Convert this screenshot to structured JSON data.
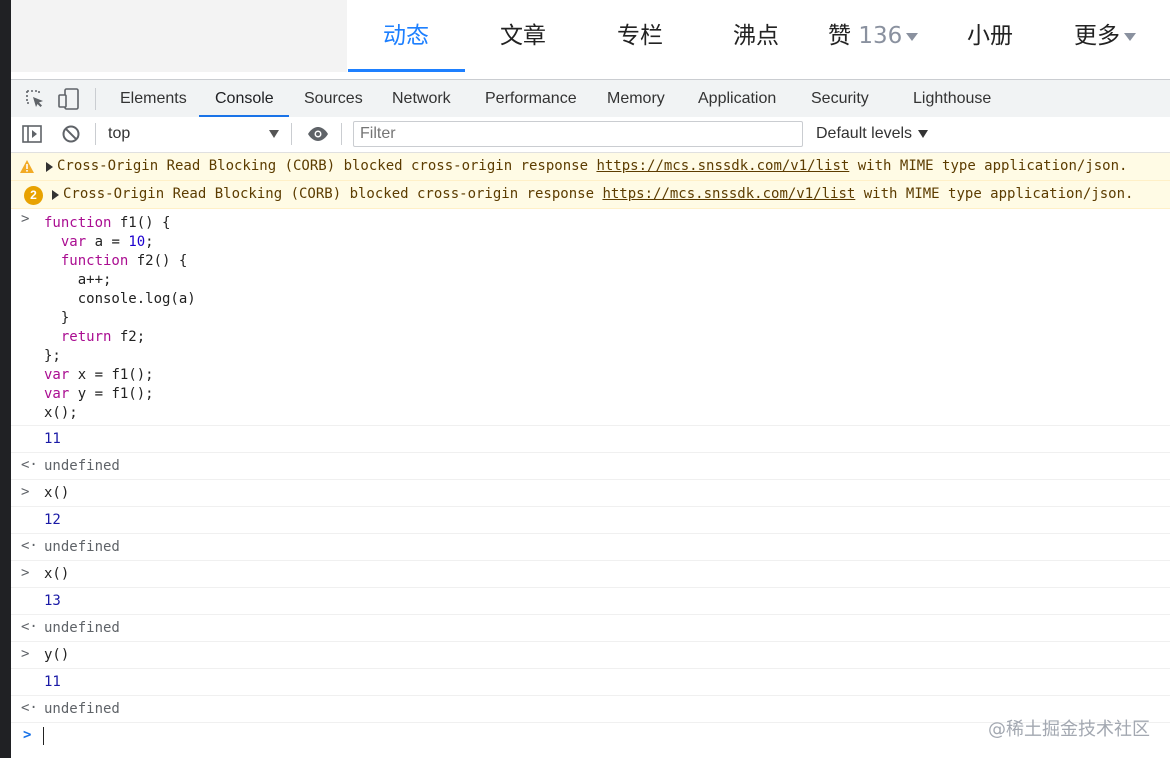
{
  "site_nav": {
    "items": [
      {
        "label": "动态"
      },
      {
        "label": "文章"
      },
      {
        "label": "专栏"
      },
      {
        "label": "沸点"
      },
      {
        "label": "赞",
        "count": "136"
      },
      {
        "label": "小册"
      },
      {
        "label": "更多"
      }
    ]
  },
  "devtools": {
    "tabs": [
      "Elements",
      "Console",
      "Sources",
      "Network",
      "Performance",
      "Memory",
      "Application",
      "Security",
      "Lighthouse"
    ],
    "active_tab": "Console",
    "context": "top",
    "filter_placeholder": "Filter",
    "levels": "Default levels"
  },
  "console": {
    "warnings": [
      {
        "text": "Cross-Origin Read Blocking (CORB) blocked cross-origin response ",
        "link": "https://mcs.snssdk.com/v1/list",
        "tail": " with MIME type application/json."
      },
      {
        "count": "2",
        "text": "Cross-Origin Read Blocking (CORB) blocked cross-origin response ",
        "link": "https://mcs.snssdk.com/v1/list",
        "tail": " with MIME type application/json."
      }
    ],
    "entries": [
      {
        "type": "input",
        "code": "function f1() {\n  var a = 10;\n  function f2() {\n    a++;\n    console.log(a)\n  }\n  return f2;\n};\nvar x = f1();\nvar y = f1();\nx();"
      },
      {
        "type": "log",
        "text": "11"
      },
      {
        "type": "result",
        "text": "undefined"
      },
      {
        "type": "input",
        "code": "x()"
      },
      {
        "type": "log",
        "text": "12"
      },
      {
        "type": "result",
        "text": "undefined"
      },
      {
        "type": "input",
        "code": "x()"
      },
      {
        "type": "log",
        "text": "13"
      },
      {
        "type": "result",
        "text": "undefined"
      },
      {
        "type": "input",
        "code": "y()"
      },
      {
        "type": "log",
        "text": "11"
      },
      {
        "type": "result",
        "text": "undefined"
      }
    ]
  },
  "watermark": "@稀土掘金技术社区",
  "colors": {
    "accent": "#1e80ff",
    "devtools_accent": "#1a73e8",
    "warning_bg": "#fffbe5"
  }
}
